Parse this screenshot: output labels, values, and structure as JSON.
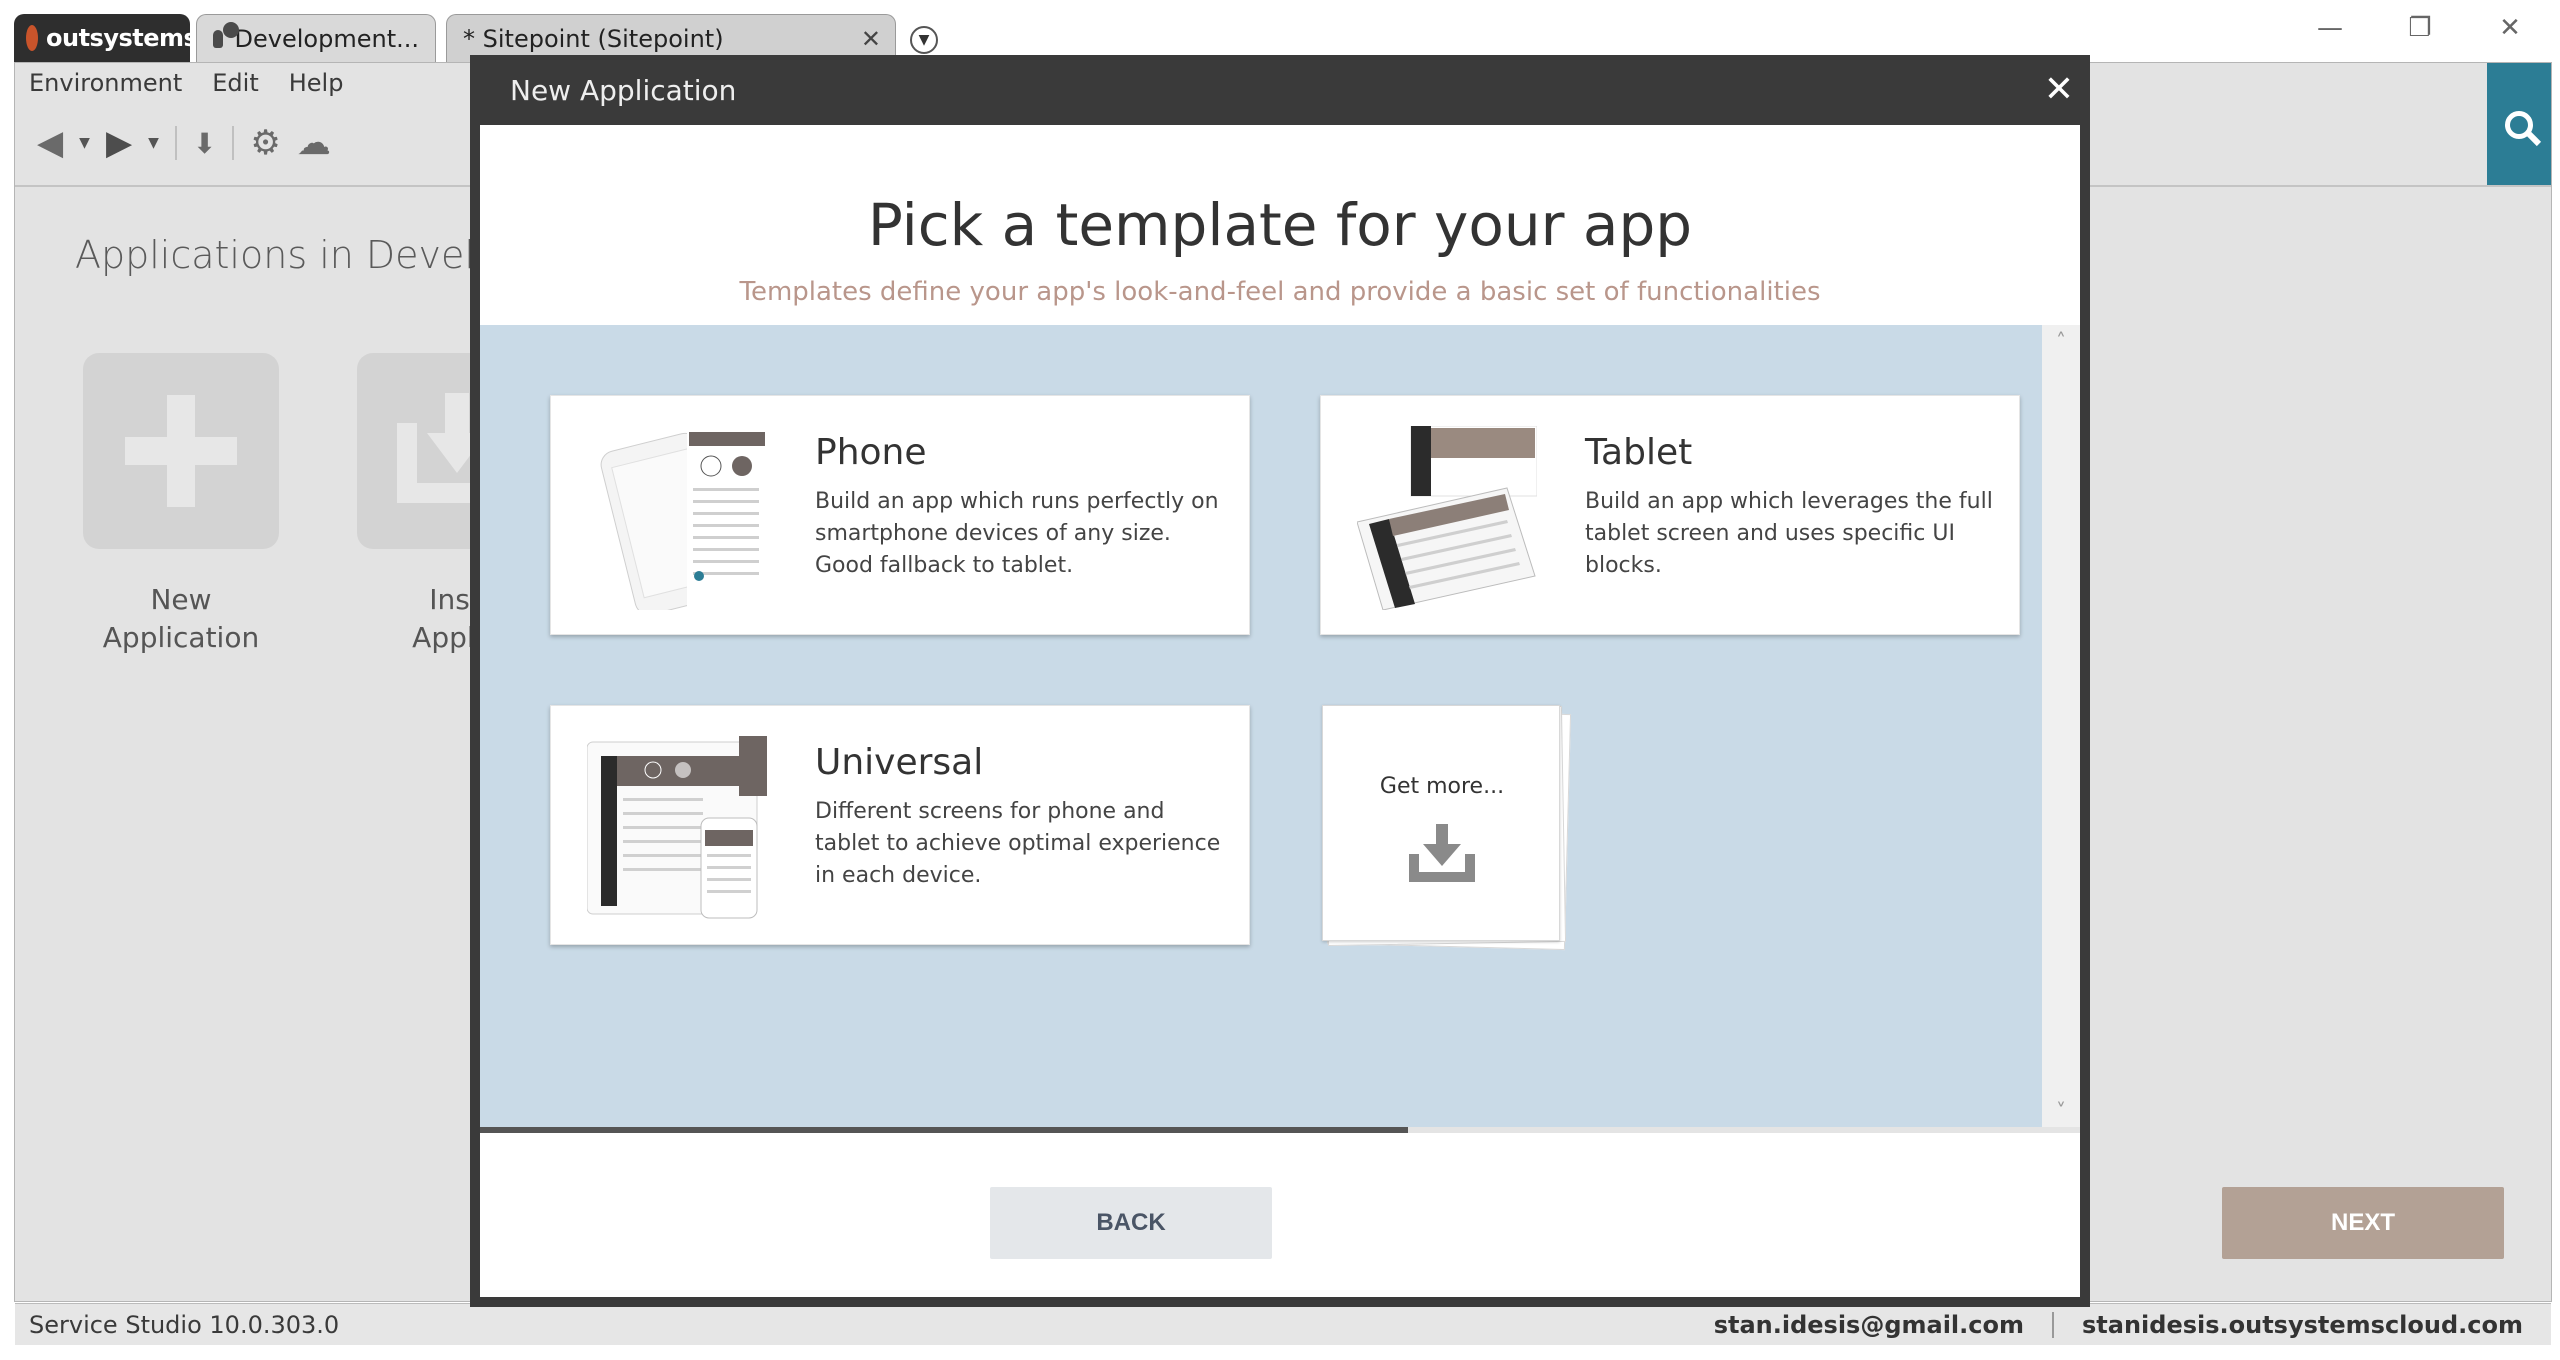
{
  "brand": {
    "name": "outsystems"
  },
  "tabs": [
    {
      "label": "Development..."
    },
    {
      "label": "* Sitepoint (Sitepoint)",
      "close": "✕"
    }
  ],
  "window_controls": {
    "minimize": "—",
    "restore": "❐",
    "close": "✕"
  },
  "menu": {
    "items": [
      "Environment",
      "Edit",
      "Help"
    ]
  },
  "main": {
    "heading": "Applications in Develo",
    "tiles": [
      {
        "label_line1": "New",
        "label_line2": "Application"
      },
      {
        "label_line1": "Inst",
        "label_line2": "Applic"
      }
    ]
  },
  "statusbar": {
    "version": "Service Studio 10.0.303.0",
    "user": "stan.idesis@gmail.com",
    "server": "stanidesis.outsystemscloud.com"
  },
  "modal": {
    "header": "New Application",
    "close": "✕",
    "title": "Pick a template for your app",
    "subtitle": "Templates define your app's look-and-feel and provide a basic set of functionalities",
    "templates": [
      {
        "title": "Phone",
        "description": "Build an app which runs perfectly on smartphone devices of any size. Good fallback to tablet."
      },
      {
        "title": "Tablet",
        "description": "Build an app which leverages the full tablet screen and uses specific UI blocks."
      },
      {
        "title": "Universal",
        "description": "Different screens for phone and tablet to achieve optimal experience in each device."
      }
    ],
    "get_more": "Get more...",
    "scroll_progress": 0.58,
    "back_label": "BACK",
    "next_label": "NEXT"
  },
  "colors": {
    "accent_search": "#2c7d95",
    "next_button": "#b3a195",
    "template_area": "#c9dae7",
    "subtitle": "#b9968b"
  }
}
